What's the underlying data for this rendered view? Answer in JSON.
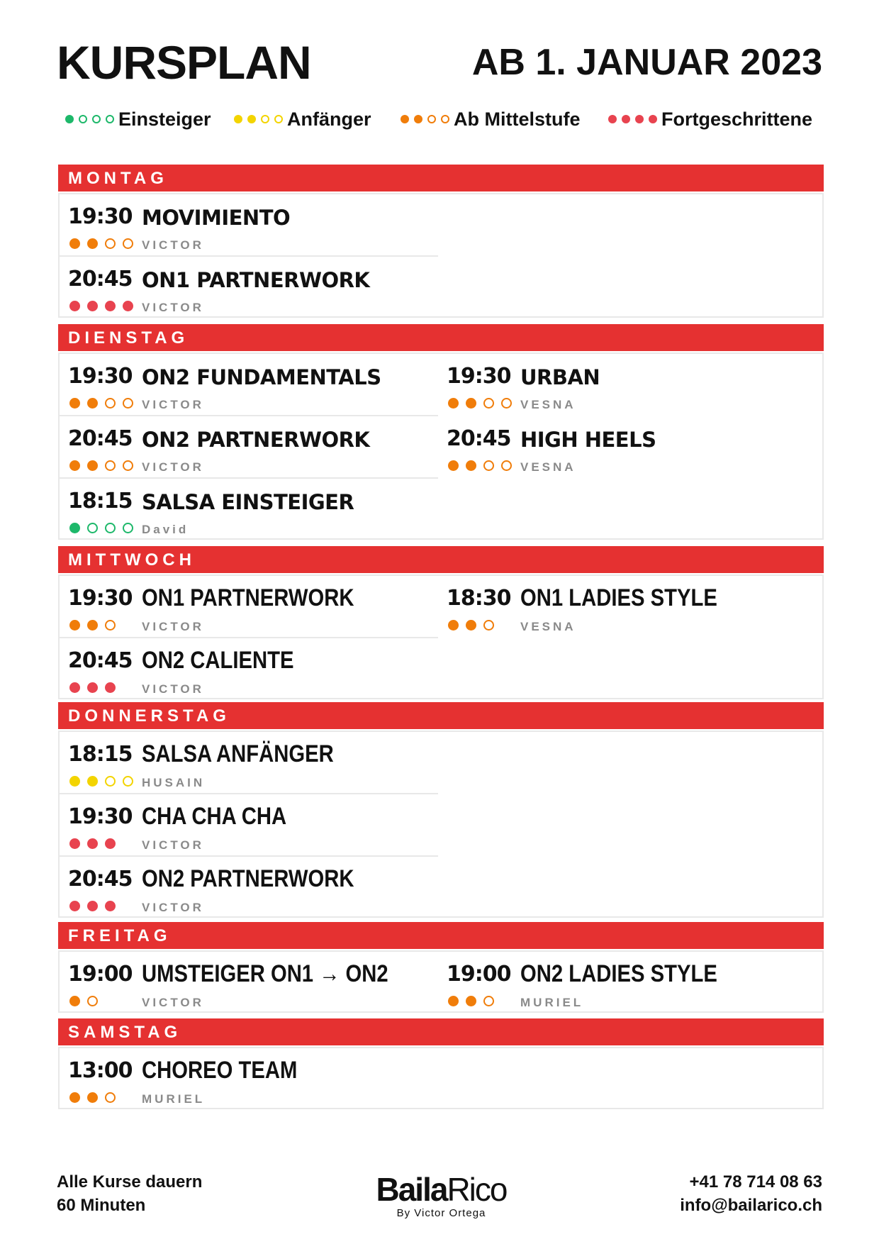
{
  "header": {
    "title": "KURSPLAN",
    "date": "AB 1. JANUAR 2023"
  },
  "colors": {
    "accent": "#e53131",
    "green": "#1db86a",
    "yellow": "#f3d400",
    "orange": "#f07d0a",
    "red": "#e8434f"
  },
  "legend": [
    {
      "label": "Einsteiger",
      "color": "green",
      "filled": 1,
      "total": 4
    },
    {
      "label": "Anfänger",
      "color": "yellow",
      "filled": 2,
      "total": 4
    },
    {
      "label": "Ab Mittelstufe",
      "color": "orange",
      "filled": 2,
      "total": 4
    },
    {
      "label": "Fortgeschrittene",
      "color": "red",
      "filled": 4,
      "total": 4
    }
  ],
  "days": [
    {
      "name": "MONTAG",
      "rows": [
        [
          {
            "time": "19:30",
            "course": "MOVIMIENTO",
            "teacher": "VICTOR",
            "level": {
              "color": "orange",
              "filled": 2,
              "total": 4
            }
          }
        ],
        [
          {
            "time": "20:45",
            "course": "ON1 PARTNERWORK",
            "teacher": "VICTOR",
            "level": {
              "color": "red",
              "filled": 4,
              "total": 4
            }
          }
        ]
      ]
    },
    {
      "name": "DIENSTAG",
      "rows": [
        [
          {
            "time": "19:30",
            "course": "ON2 FUNDAMENTALS",
            "teacher": "VICTOR",
            "level": {
              "color": "orange",
              "filled": 2,
              "total": 4
            }
          },
          {
            "time": "19:30",
            "course": "URBAN",
            "teacher": "VESNA",
            "level": {
              "color": "orange",
              "filled": 2,
              "total": 4
            }
          }
        ],
        [
          {
            "time": "20:45",
            "course": "ON2 PARTNERWORK",
            "teacher": "VICTOR",
            "level": {
              "color": "orange",
              "filled": 2,
              "total": 4
            }
          },
          {
            "time": "20:45",
            "course": "HIGH HEELS",
            "teacher": "VESNA",
            "level": {
              "color": "orange",
              "filled": 2,
              "total": 4
            }
          }
        ],
        [
          {
            "time": "18:15",
            "course": "SALSA EINSTEIGER",
            "teacher": "David",
            "level": {
              "color": "green",
              "filled": 1,
              "total": 4
            }
          }
        ]
      ]
    },
    {
      "name": "MITTWOCH",
      "rows": [
        [
          {
            "time": "19:30",
            "course": "ON1 PARTNERWORK",
            "teacher": "VICTOR",
            "level": {
              "color": "orange",
              "filled": 2,
              "total": 3
            }
          },
          {
            "time": "18:30",
            "course": "ON1 LADIES STYLE",
            "teacher": "VESNA",
            "level": {
              "color": "orange",
              "filled": 2,
              "total": 3
            }
          }
        ],
        [
          {
            "time": "20:45",
            "course": "ON2 CALIENTE",
            "teacher": "VICTOR",
            "level": {
              "color": "red",
              "filled": 3,
              "total": 3
            }
          }
        ]
      ]
    },
    {
      "name": "DONNERSTAG",
      "rows": [
        [
          {
            "time": "18:15",
            "course": "SALSA ANFÄNGER",
            "teacher": "HUSAIN",
            "level": {
              "color": "yellow",
              "filled": 2,
              "total": 4
            }
          }
        ],
        [
          {
            "time": "19:30",
            "course": "CHA CHA CHA",
            "teacher": "VICTOR",
            "level": {
              "color": "red",
              "filled": 3,
              "total": 3
            }
          }
        ],
        [
          {
            "time": "20:45",
            "course": "ON2 PARTNERWORK",
            "teacher": "VICTOR",
            "level": {
              "color": "red",
              "filled": 3,
              "total": 3
            }
          }
        ]
      ]
    },
    {
      "name": "FREITAG",
      "rows": [
        [
          {
            "time": "19:00",
            "course": "UMSTEIGER ON1 → ON2",
            "teacher": "VICTOR",
            "level": {
              "color": "orange",
              "filled": 1,
              "total": 2
            }
          },
          {
            "time": "19:00",
            "course": "ON2 LADIES STYLE",
            "teacher": "MURIEL",
            "level": {
              "color": "orange",
              "filled": 2,
              "total": 3
            }
          }
        ]
      ]
    },
    {
      "name": "SAMSTAG",
      "rows": [
        [
          {
            "time": "13:00",
            "course": "CHOREO TEAM",
            "teacher": "MURIEL",
            "level": {
              "color": "orange",
              "filled": 2,
              "total": 3
            }
          }
        ]
      ]
    }
  ],
  "footer": {
    "duration_line1": "Alle Kurse dauern",
    "duration_line2": "60 Minuten",
    "logo_bold": "Baila",
    "logo_regular": "Rico",
    "logo_sub": "By Victor Ortega",
    "phone": "+41 78 714 08 63",
    "email": "info@bailarico.ch"
  }
}
